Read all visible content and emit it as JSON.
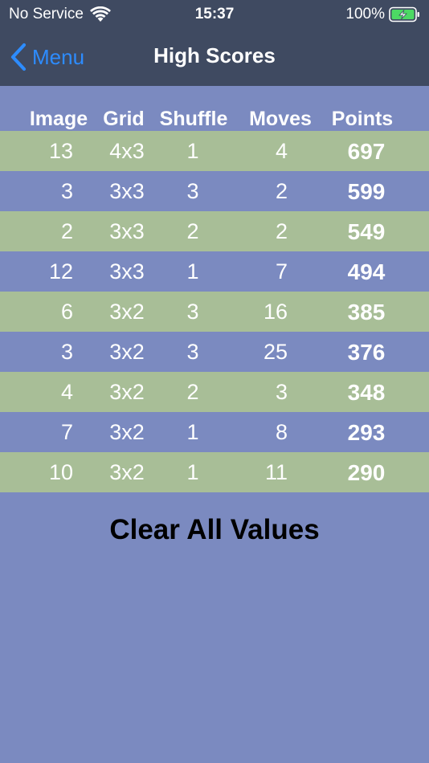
{
  "status": {
    "carrier": "No Service",
    "time": "15:37",
    "battery": "100%"
  },
  "nav": {
    "back_label": "Menu",
    "title": "High Scores"
  },
  "table": {
    "headers": [
      "Image",
      "Grid",
      "Shuffle",
      "Moves",
      "Points"
    ],
    "rows": [
      {
        "image": "13",
        "grid": "4x3",
        "shuffle": "1",
        "moves": "4",
        "points": "697"
      },
      {
        "image": "3",
        "grid": "3x3",
        "shuffle": "3",
        "moves": "2",
        "points": "599"
      },
      {
        "image": "2",
        "grid": "3x3",
        "shuffle": "2",
        "moves": "2",
        "points": "549"
      },
      {
        "image": "12",
        "grid": "3x3",
        "shuffle": "1",
        "moves": "7",
        "points": "494"
      },
      {
        "image": "6",
        "grid": "3x2",
        "shuffle": "3",
        "moves": "16",
        "points": "385"
      },
      {
        "image": "3",
        "grid": "3x2",
        "shuffle": "3",
        "moves": "25",
        "points": "376"
      },
      {
        "image": "4",
        "grid": "3x2",
        "shuffle": "2",
        "moves": "3",
        "points": "348"
      },
      {
        "image": "7",
        "grid": "3x2",
        "shuffle": "1",
        "moves": "8",
        "points": "293"
      },
      {
        "image": "10",
        "grid": "3x2",
        "shuffle": "1",
        "moves": "11",
        "points": "290"
      }
    ]
  },
  "clear_label": "Clear All Values",
  "icons": {
    "wifi": "wifi-icon",
    "battery": "battery-charging-icon",
    "back": "chevron-left-icon"
  },
  "colors": {
    "nav_background": "#3f4a61",
    "page_background": "#7b8ac0",
    "row_highlight": "#a8be97",
    "accent": "#2d8cff",
    "battery_green": "#4cd964"
  }
}
